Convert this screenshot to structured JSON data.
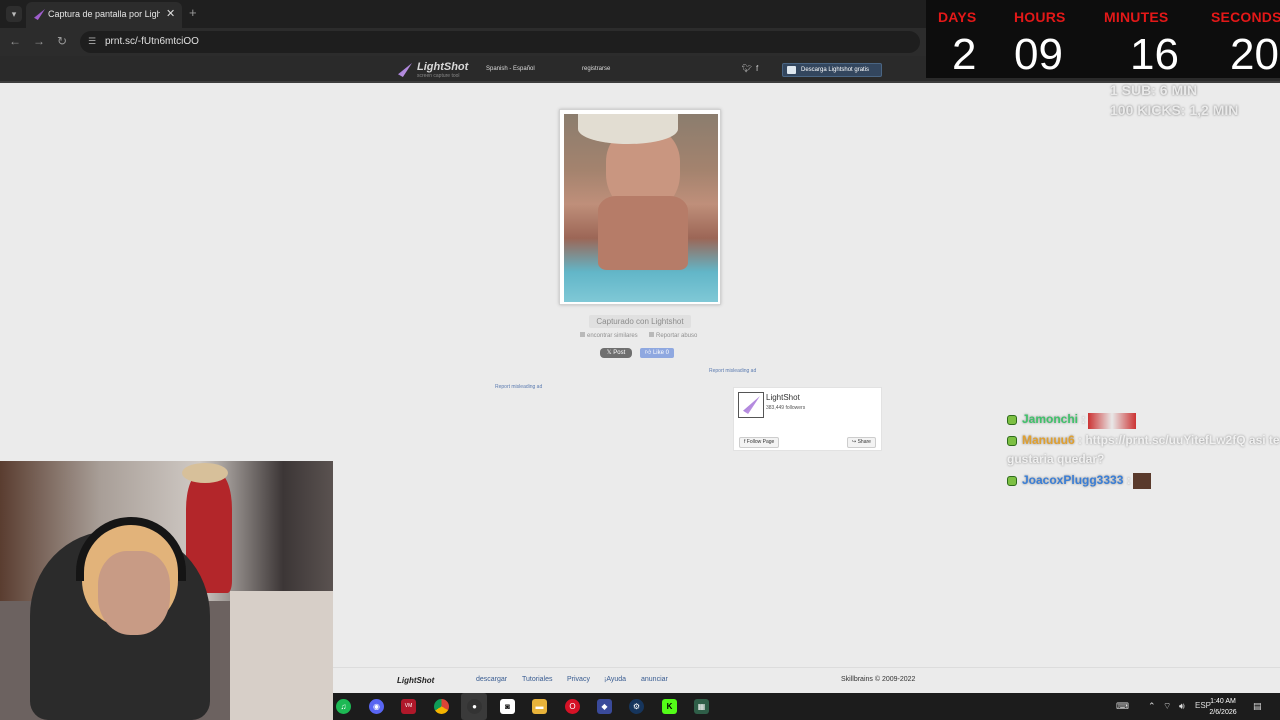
{
  "browser": {
    "tab_title": "Captura de pantalla por Lightshot",
    "url": "prnt.sc/-fUtn6mtciOO"
  },
  "lightshot_header": {
    "logo": "LightShot",
    "tagline": "screen capture tool",
    "language": "Spanish - Español",
    "register": "registrarse",
    "download": "Descarga Lightshot gratis"
  },
  "countdown": {
    "days_label": "DAYS",
    "days": "2",
    "hours_label": "HOURS",
    "hours": "09",
    "minutes_label": "MINUTES",
    "minutes": "16",
    "seconds_label": "SECONDS",
    "seconds": "20",
    "label_color": "#e31818"
  },
  "sub_info": {
    "line1": "1 SUB: 6 MIN",
    "line2": "100 KICKS: 1,2 MIN"
  },
  "screenshot": {
    "caption": "Capturado con Lightshot",
    "similar": "encontrar similares",
    "report_abuse": "Reportar abuso",
    "post": "Post",
    "like": "Like 0",
    "report_ad_right": "Report misleading ad",
    "report_ad_left": "Report misleading ad"
  },
  "fb_widget": {
    "name": "LightShot",
    "followers": "383,449 followers",
    "follow": "Follow Page",
    "share": "Share"
  },
  "chat": [
    {
      "user": "Jamonchi",
      "message": "",
      "color": "#3fc26a"
    },
    {
      "user": "Manuuu6",
      "message": "https://prnt.sc/uuYitefLw2fQ asi te",
      "message2": "gustaria quedar?",
      "color": "#e0a030"
    },
    {
      "user": "JoacoxPlugg3333",
      "message": "",
      "color": "#3a7ed6"
    }
  ],
  "footer": {
    "logo": "LightShot",
    "links": [
      "descargar",
      "Tutoriales",
      "Privacy",
      "¡Ayuda",
      "anunciar"
    ],
    "copyright": "Skillbrains © 2009-2022"
  },
  "taskbar": {
    "lang": "ESP",
    "time": "1:40 AM",
    "date": "2/6/2026"
  }
}
